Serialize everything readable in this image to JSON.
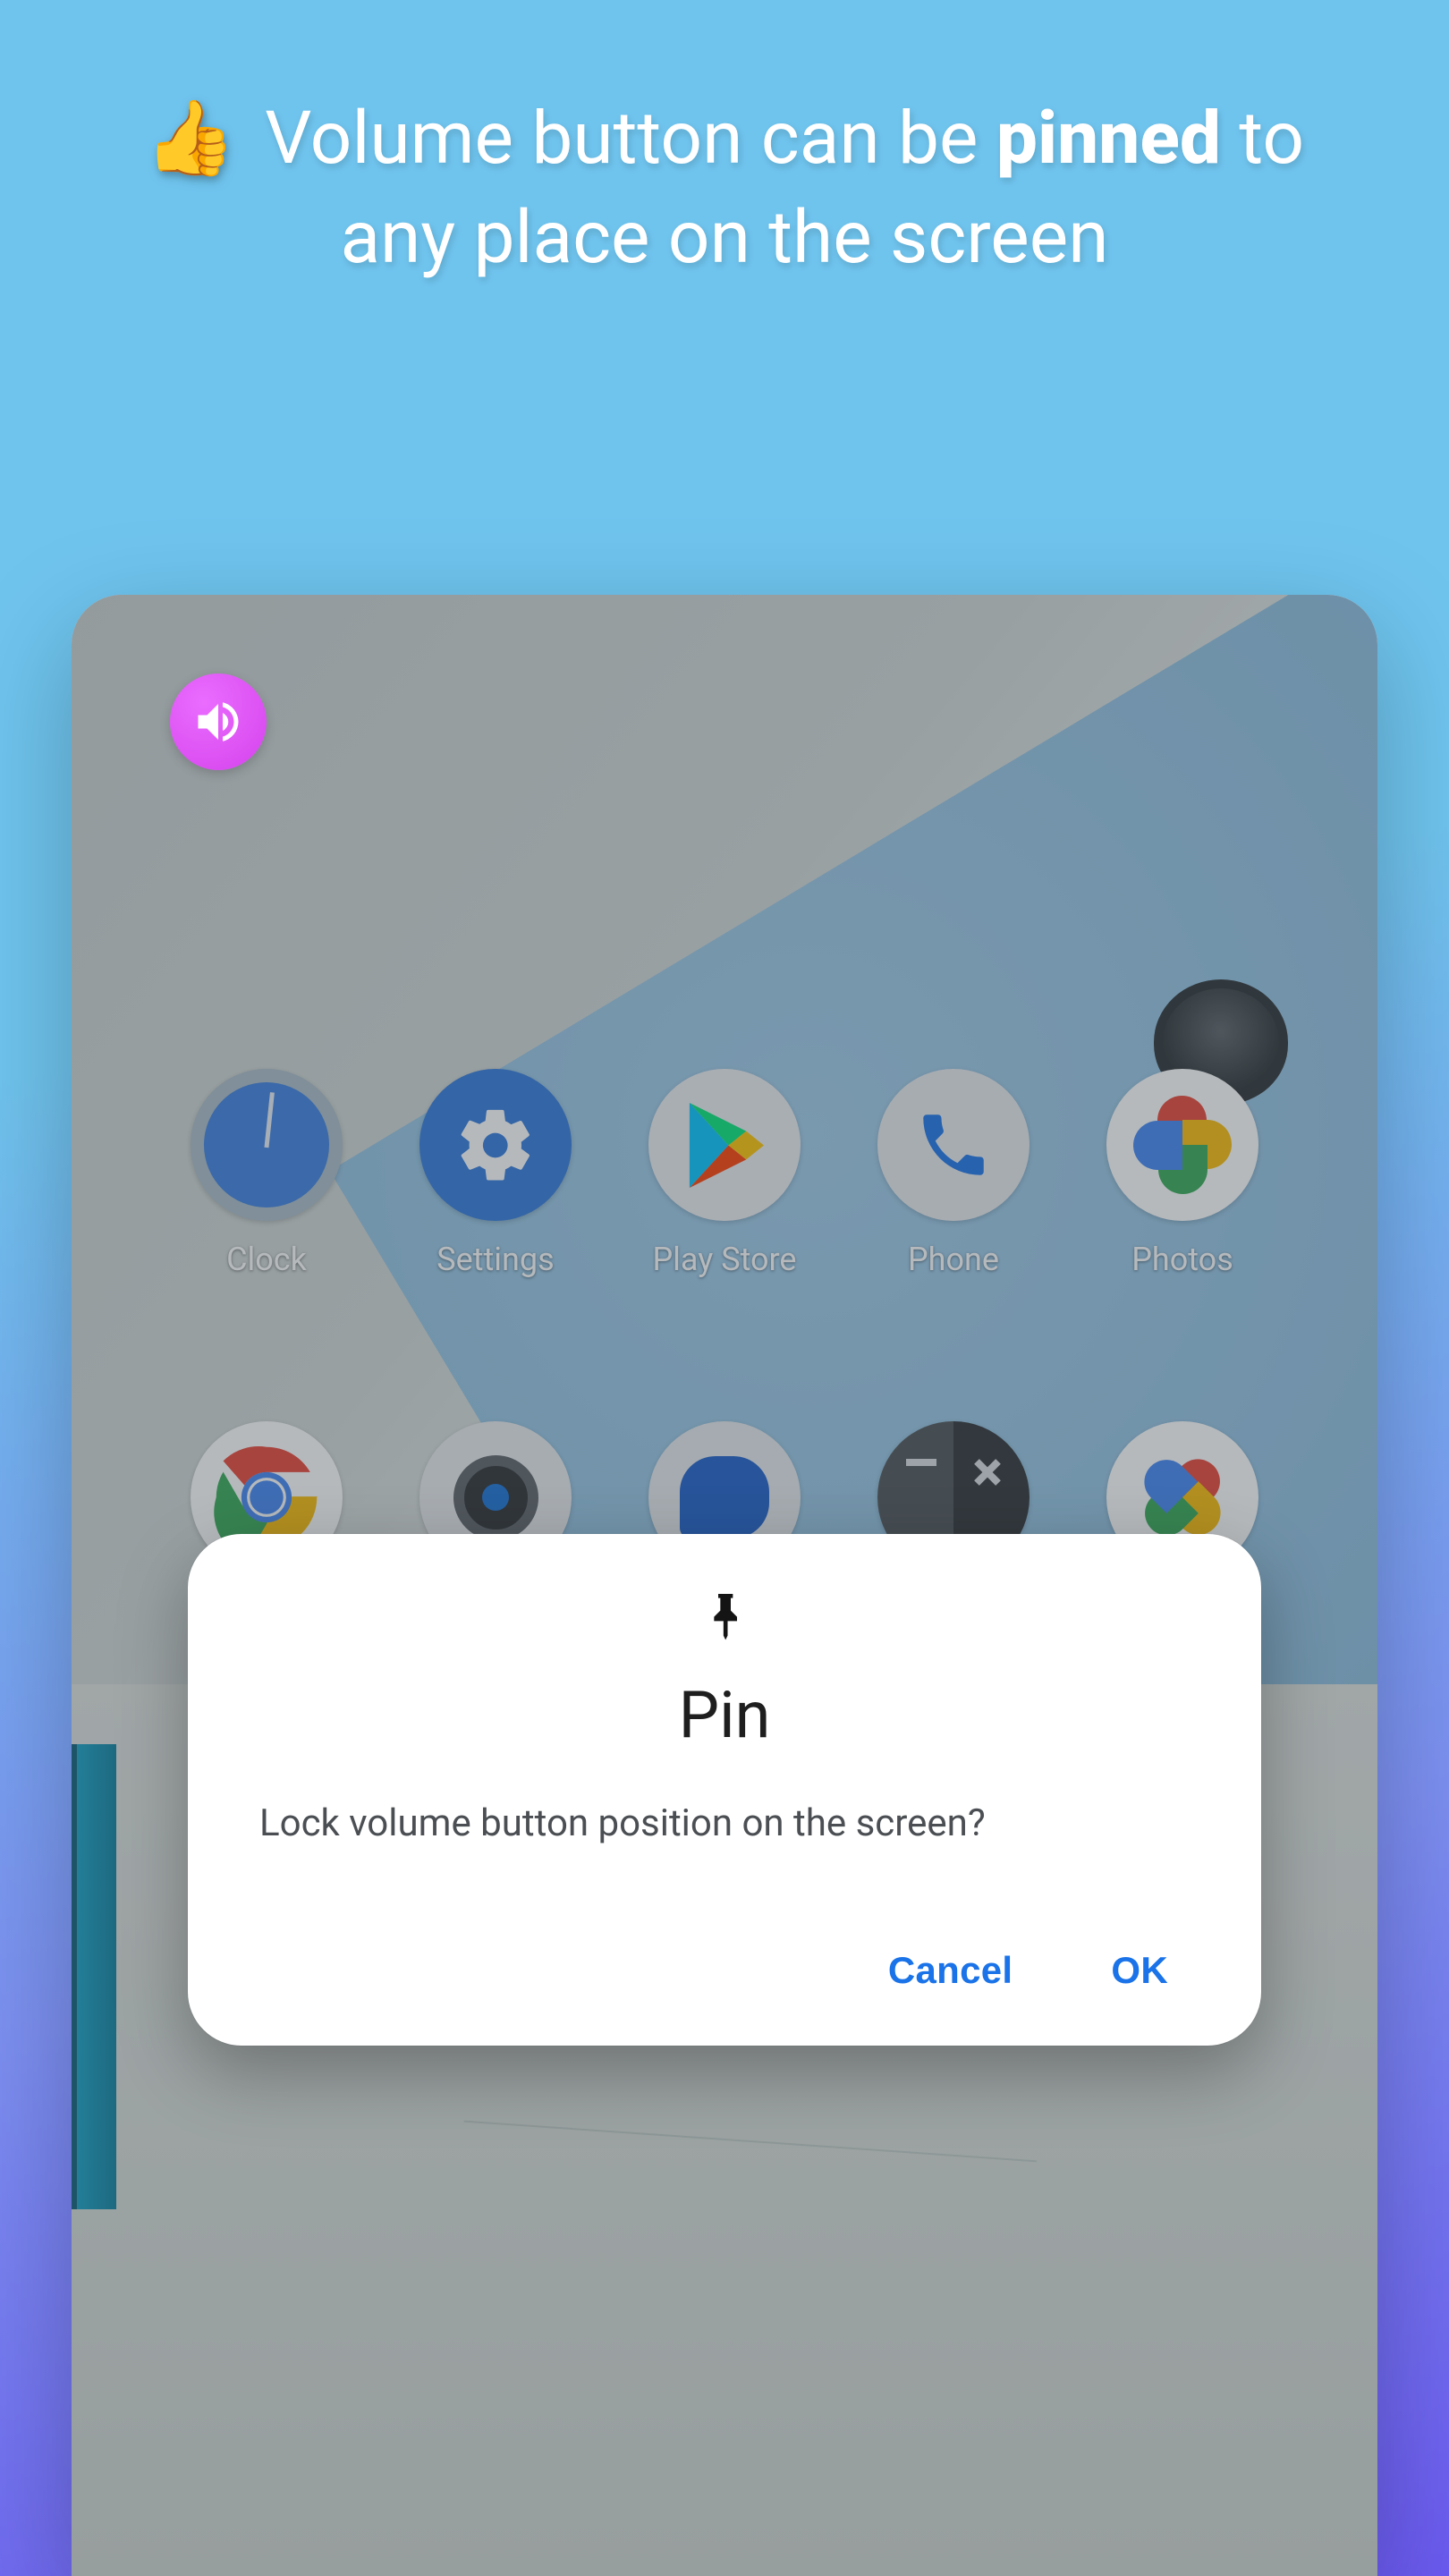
{
  "hero": {
    "emoji": "👍",
    "pre": " Volume button can be ",
    "bold": "pinned",
    "post": " to any place on the screen"
  },
  "volume_button": {
    "icon": "speaker-icon"
  },
  "apps_row1": [
    {
      "id": "clock",
      "label": "Clock"
    },
    {
      "id": "settings",
      "label": "Settings"
    },
    {
      "id": "playstore",
      "label": "Play Store"
    },
    {
      "id": "phone",
      "label": "Phone"
    },
    {
      "id": "photos",
      "label": "Photos"
    }
  ],
  "apps_row2": [
    {
      "id": "chrome",
      "label": ""
    },
    {
      "id": "camera",
      "label": ""
    },
    {
      "id": "messages",
      "label": ""
    },
    {
      "id": "calc",
      "label": ""
    },
    {
      "id": "google",
      "label": ""
    }
  ],
  "dialog": {
    "title": "Pin",
    "body": "Lock volume button position on the screen?",
    "cancel": "Cancel",
    "ok": "OK"
  },
  "colors": {
    "accent": "#1a73e8",
    "volume_bubble": "#dd52f2"
  }
}
